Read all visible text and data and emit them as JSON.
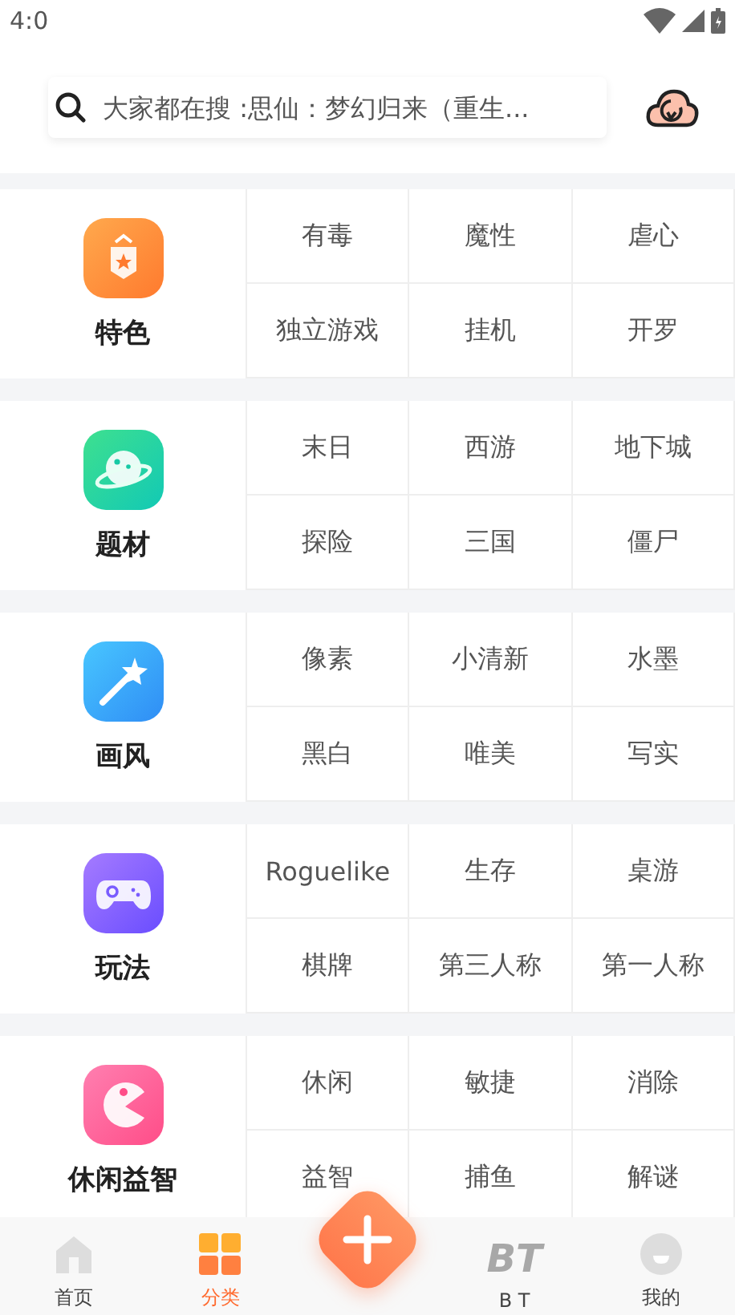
{
  "status_bar": {
    "time": "4:0"
  },
  "search": {
    "placeholder": "大家都在搜 :思仙：梦幻归来（重生..."
  },
  "categories": [
    {
      "kind": "badge",
      "title": "特色",
      "tags": [
        "有毒",
        "魔性",
        "虐心",
        "独立游戏",
        "挂机",
        "开罗"
      ]
    },
    {
      "kind": "planet",
      "title": "题材",
      "tags": [
        "末日",
        "西游",
        "地下城",
        "探险",
        "三国",
        "僵尸"
      ]
    },
    {
      "kind": "wand",
      "title": "画风",
      "tags": [
        "像素",
        "小清新",
        "水墨",
        "黑白",
        "唯美",
        "写实"
      ]
    },
    {
      "kind": "gamepad",
      "title": "玩法",
      "tags": [
        "Roguelike",
        "生存",
        "桌游",
        "棋牌",
        "第三人称",
        "第一人称"
      ]
    },
    {
      "kind": "pacman",
      "title": "休闲益智",
      "tags": [
        "休闲",
        "敏捷",
        "消除",
        "益智",
        "捕鱼",
        "解谜"
      ]
    }
  ],
  "nav": [
    {
      "kind": "home",
      "label": "首页",
      "selected": false
    },
    {
      "kind": "grid",
      "label": "分类",
      "selected": true
    },
    {
      "kind": "plus"
    },
    {
      "kind": "bt",
      "glyph": "BT",
      "label": "B T",
      "selected": false
    },
    {
      "kind": "face",
      "label": "我的",
      "selected": false
    }
  ]
}
